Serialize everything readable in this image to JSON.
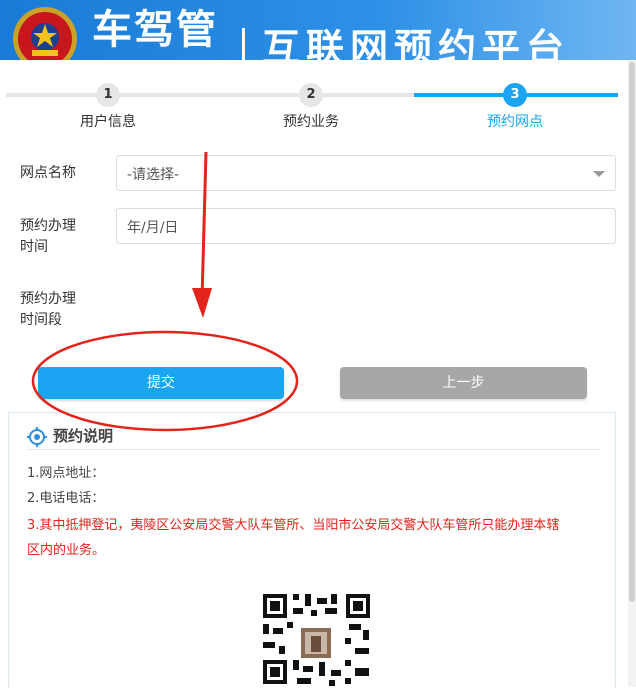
{
  "header": {
    "brand": "车驾管",
    "platform": "互联网预约平台"
  },
  "steps": [
    {
      "number": "1",
      "label": "用户信息",
      "state": "done"
    },
    {
      "number": "2",
      "label": "预约业务",
      "state": "done"
    },
    {
      "number": "3",
      "label": "预约网点",
      "state": "active"
    }
  ],
  "form": {
    "outlet_label": "网点名称",
    "outlet_value": "-请选择-",
    "time_label_1": "预约办理",
    "time_label_2": "时间",
    "time_value": "年/月/日",
    "period_label_1": "预约办理",
    "period_label_2": "时间段"
  },
  "buttons": {
    "submit": "提交",
    "previous": "上一步"
  },
  "notes": {
    "title": "预约说明",
    "address": "1.网点地址：",
    "phone": "2.电话电话：",
    "warning_line1": "3.其中抵押登记，夷陵区公安局交警大队车管所、当阳市公安局交警大队车管所只能办理本辖",
    "warning_line2": "区内的业务。"
  },
  "colors": {
    "accent": "#1aa4f2",
    "header": "#1a7bd6",
    "warning": "#e4231a",
    "annotation": "#e4231a"
  }
}
